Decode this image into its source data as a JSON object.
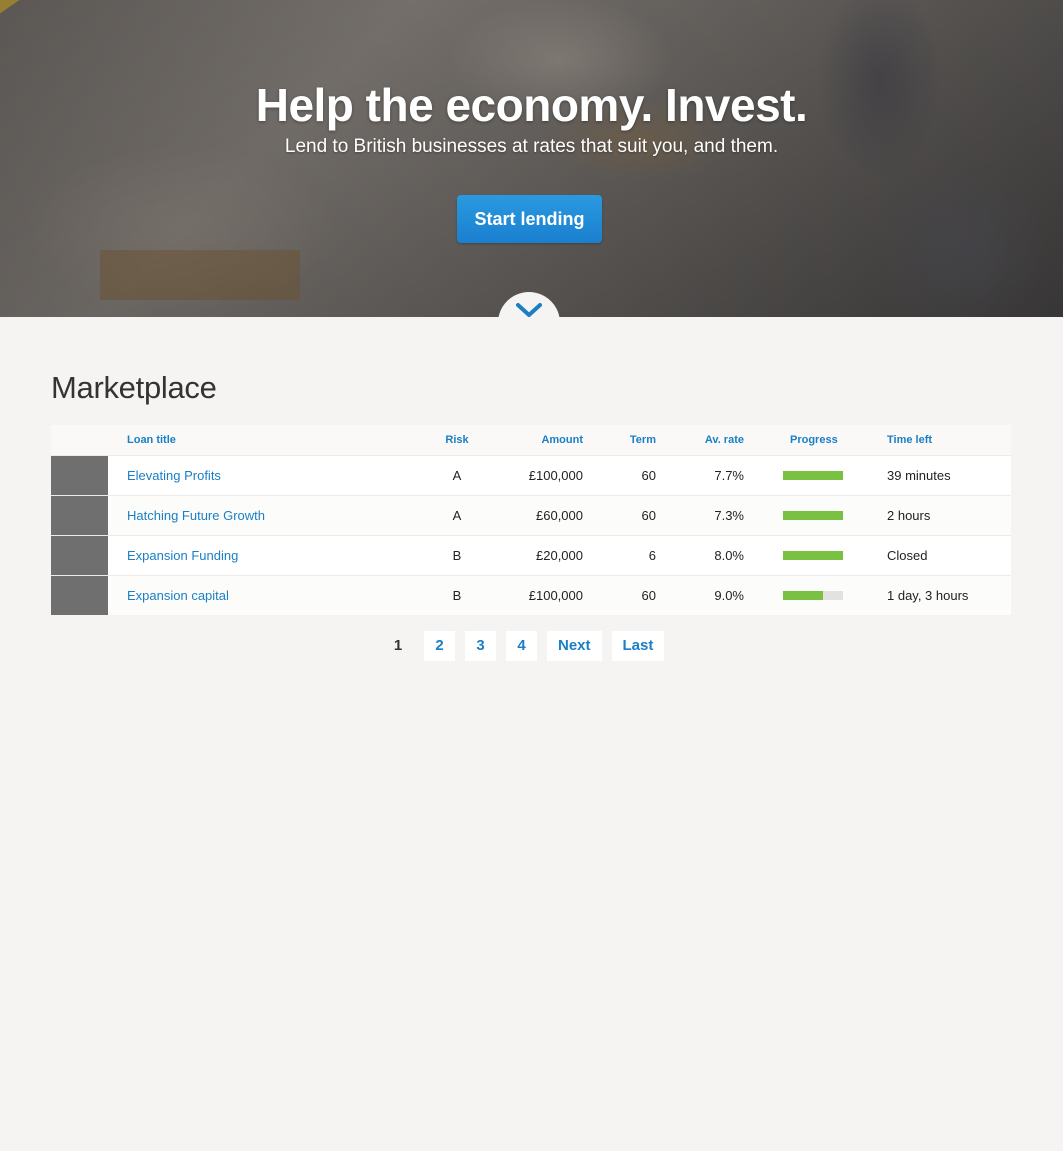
{
  "hero": {
    "title": "Help the economy. Invest.",
    "subtitle": "Lend to British businesses at rates that suit you, and them.",
    "cta_label": "Start lending",
    "scroll_icon": "chevron-down-icon"
  },
  "marketplace": {
    "title": "Marketplace",
    "columns": [
      "Loan title",
      "Risk",
      "Amount",
      "Term",
      "Av. rate",
      "Progress",
      "Time left"
    ],
    "loans": [
      {
        "title": "Elevating Profits",
        "risk": "A",
        "amount": "£100,000",
        "term": "60",
        "rate": "7.7%",
        "progress": 1.0,
        "time_left": "39 minutes"
      },
      {
        "title": "Hatching Future Growth",
        "risk": "A",
        "amount": "£60,000",
        "term": "60",
        "rate": "7.3%",
        "progress": 1.0,
        "time_left": "2 hours"
      },
      {
        "title": "Expansion Funding",
        "risk": "B",
        "amount": "£20,000",
        "term": "6",
        "rate": "8.0%",
        "progress": 1.0,
        "time_left": "Closed"
      },
      {
        "title": "Expansion capital",
        "risk": "B",
        "amount": "£100,000",
        "term": "60",
        "rate": "9.0%",
        "progress": 0.67,
        "time_left": "1 day, 3 hours"
      }
    ]
  },
  "pagination": {
    "current": "1",
    "pages": [
      "2",
      "3",
      "4"
    ],
    "next_label": "Next",
    "last_label": "Last"
  },
  "colors": {
    "accent": "#1a7fc4",
    "progress": "#7ac143",
    "background": "#f5f4f2"
  }
}
